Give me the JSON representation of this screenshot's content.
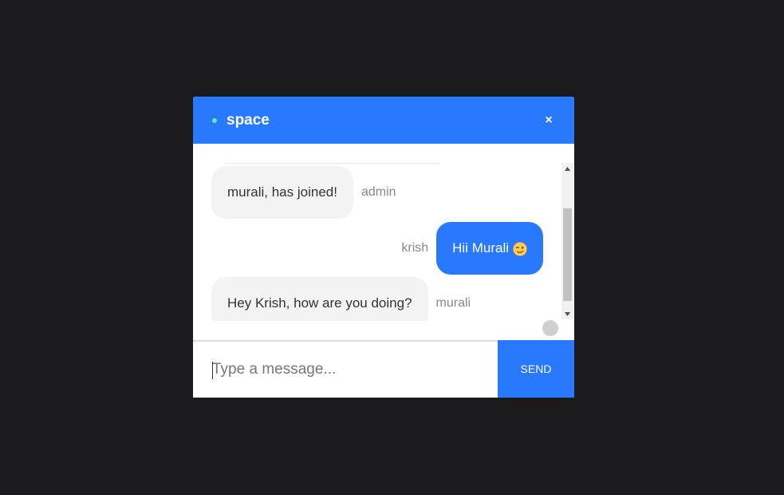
{
  "header": {
    "room_name": "space",
    "close_symbol": "×",
    "status_color": "#5ef0a2",
    "accent_color": "#2979ff"
  },
  "messages": [
    {
      "text": "murali, has joined!",
      "sender": "admin",
      "direction": "received"
    },
    {
      "text": "Hii Murali",
      "sender": "krish",
      "direction": "sent",
      "emoji": "winking-face-icon"
    },
    {
      "text": "Hey Krish, how are you doing?",
      "sender": "murali",
      "direction": "received"
    }
  ],
  "composer": {
    "placeholder": "Type a message...",
    "value": "",
    "send_label": "SEND"
  }
}
